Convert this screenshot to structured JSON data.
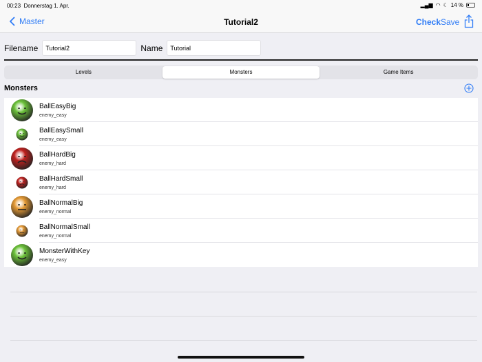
{
  "status": {
    "time": "00:23",
    "date": "Donnerstag 1. Apr.",
    "battery": "14 %"
  },
  "nav": {
    "back": "Master",
    "title": "Tutorial2",
    "check": "Check",
    "save": "Save"
  },
  "form": {
    "filename_label": "Filename",
    "filename_value": "Tutorial2",
    "name_label": "Name",
    "name_value": "Tutorial"
  },
  "tabs": [
    {
      "label": "Levels"
    },
    {
      "label": "Monsters",
      "selected": true
    },
    {
      "label": "Game Items"
    }
  ],
  "section": {
    "title": "Monsters"
  },
  "colors": {
    "accent": "#2f7cf6",
    "easy": "#6cc23a",
    "hard": "#c0201e",
    "normal": "#e59a35"
  },
  "monsters": [
    {
      "name": "BallEasyBig",
      "type": "enemy_easy",
      "size": "big"
    },
    {
      "name": "BallEasySmall",
      "type": "enemy_easy",
      "size": "small"
    },
    {
      "name": "BallHardBig",
      "type": "enemy_hard",
      "size": "big"
    },
    {
      "name": "BallHardSmall",
      "type": "enemy_hard",
      "size": "small"
    },
    {
      "name": "BallNormalBig",
      "type": "enemy_normal",
      "size": "big"
    },
    {
      "name": "BallNormalSmall",
      "type": "enemy_normal",
      "size": "small"
    },
    {
      "name": "MonsterWithKey",
      "type": "enemy_easy",
      "size": "big"
    }
  ]
}
